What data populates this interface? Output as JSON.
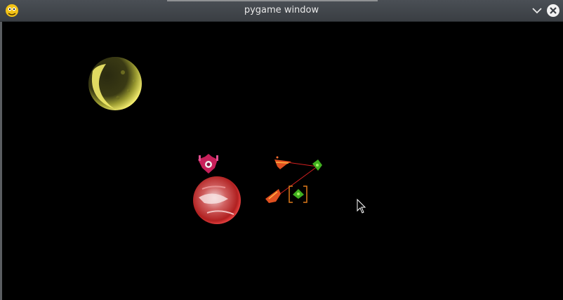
{
  "window": {
    "title": "pygame window",
    "app_icon": "pygame-snake-icon",
    "minimize_icon": "chevron-down-icon",
    "close_icon": "close-icon"
  },
  "scene": {
    "planets": [
      {
        "name": "yellow-planet",
        "color": "#e8e050"
      },
      {
        "name": "red-planet",
        "color": "#d84040"
      }
    ],
    "ships": [
      {
        "name": "pink-starbase",
        "color": "#c8205a"
      },
      {
        "name": "red-fighter",
        "color": "#e05020"
      },
      {
        "name": "red-fighter",
        "color": "#e05020"
      },
      {
        "name": "green-fighter",
        "color": "#40b020"
      },
      {
        "name": "green-fighter-selected",
        "color": "#40b020"
      }
    ],
    "laser_color": "#d02020",
    "selection_color": "#e07a1a",
    "cursor": "mouse-pointer-icon"
  }
}
